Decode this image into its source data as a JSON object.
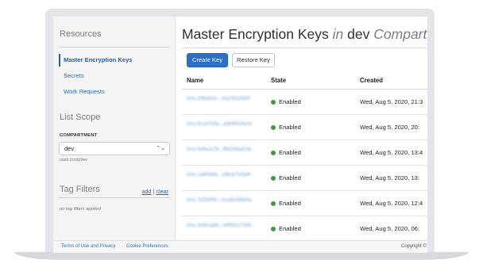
{
  "sidebar": {
    "resources_title": "Resources",
    "nav": [
      {
        "label": "Master Encryption Keys",
        "active": true
      },
      {
        "label": "Secrets",
        "active": false
      },
      {
        "label": "Work Requests",
        "active": false
      }
    ],
    "list_scope_title": "List Scope",
    "compartment_label": "COMPARTMENT",
    "compartment_value": "dev",
    "compartment_path": "oasb (root)/dev",
    "tag_filters_title": "Tag Filters",
    "tag_add": "add",
    "tag_sep": "|",
    "tag_clear": "clear",
    "no_tags": "no tag filters applied"
  },
  "main": {
    "title_part1": "Master Encryption Keys",
    "title_in": "in",
    "title_part2": "dev",
    "title_part3": "Compartment",
    "create_button": "Create Key",
    "restore_button": "Restore Key",
    "columns": [
      "Name",
      "State",
      "Created"
    ],
    "rows": [
      {
        "name": "kms-2f6b9e4c...d1a7b3c5e9f",
        "state": "Enabled",
        "created": "Wed, Aug 5, 2020, 21:3"
      },
      {
        "name": "kms-8c1d7e5a...a3b6f4c9e2d",
        "state": "Enabled",
        "created": "Wed, Aug 5, 2020, 20:"
      },
      {
        "name": "kms-5e9a2c7b...f8d1b6a4c3e",
        "state": "Enabled",
        "created": "Wed, Aug 5, 2020, 13:4"
      },
      {
        "name": "kms-1a6f3d8e...c9b2e7a5d4f",
        "state": "Enabled",
        "created": "Wed, Aug 5, 2020, 13:"
      },
      {
        "name": "kms-7d2b5f9c...e1a8c3d6b9a",
        "state": "Enabled",
        "created": "Wed, Aug 5, 2020, 12:4"
      },
      {
        "name": "kms-3c8e1a6d...b4f9d2c7e5b",
        "state": "Enabled",
        "created": "Wed, Aug 5, 2020, 06:"
      }
    ]
  },
  "footer": {
    "terms": "Terms of Use and Privacy",
    "cookies": "Cookie Preferences",
    "copyright": "Copyright ©"
  },
  "colors": {
    "accent": "#2c6fc7",
    "enabled": "#3f9a3b"
  }
}
